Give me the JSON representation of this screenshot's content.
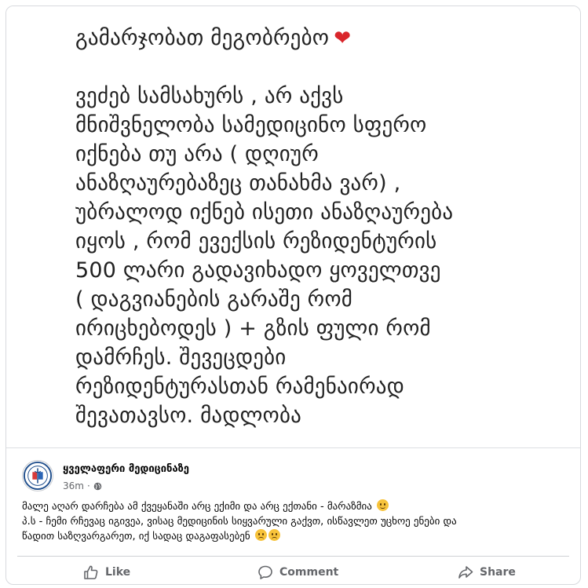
{
  "image_text": {
    "line1": "გამარჯობათ მეგობრებო",
    "line2": "ვეძებ სამსახურს , არ აქვს",
    "line3": "მნიშვნელობა  სამედიცინო სფერო",
    "line4": "იქნება თუ არა ( დღიურ",
    "line5": "ანაზღაურებაზეც თანახმა ვარ) ,",
    "line6": "უბრალოდ იქნებ ისეთი ანაზღაურება",
    "line7": "იყოს , რომ ევექსის რეზიდენტურის",
    "line8": "500 ლარი გადავიხადო ყოველთვე",
    "line9": "( დაგვიანების გარაშე რომ",
    "line10": "ირიცხებოდეს )  + გზის ფული რომ",
    "line11": "დამრჩეს. შევეცდები",
    "line12": "რეზიდენტურასთან რამენაირად",
    "line13": "შევათავსო.  მადლობა"
  },
  "post": {
    "page_name": "ყველაფერი მედიცინაზე",
    "time": "36m",
    "caption_line1": "მალე აღარ დარჩება ამ ქვეყანაში არც ექიმი და არც ექთანი  - მარაზმია",
    "caption_line2": "პ.ს - ჩემი რჩევაც იგივეა, ვისაც მედიცინის სიყვარული გაქვთ, ისწავლეთ უცხოე ენები და",
    "caption_line3": "წადით საზღვარგარეთ, იქ სადაც დაგაფასებენ"
  },
  "actions": {
    "like": "Like",
    "comment": "Comment",
    "share": "Share"
  },
  "icons": {
    "heart": "red-heart-icon",
    "globe": "globe-icon",
    "like": "thumbs-up-icon",
    "comment": "speech-bubble-icon",
    "share": "share-arrow-icon"
  },
  "colors": {
    "heart": "#d9262b",
    "meta_gray": "#65676b",
    "emoji_yellow": "#f7c33b"
  }
}
